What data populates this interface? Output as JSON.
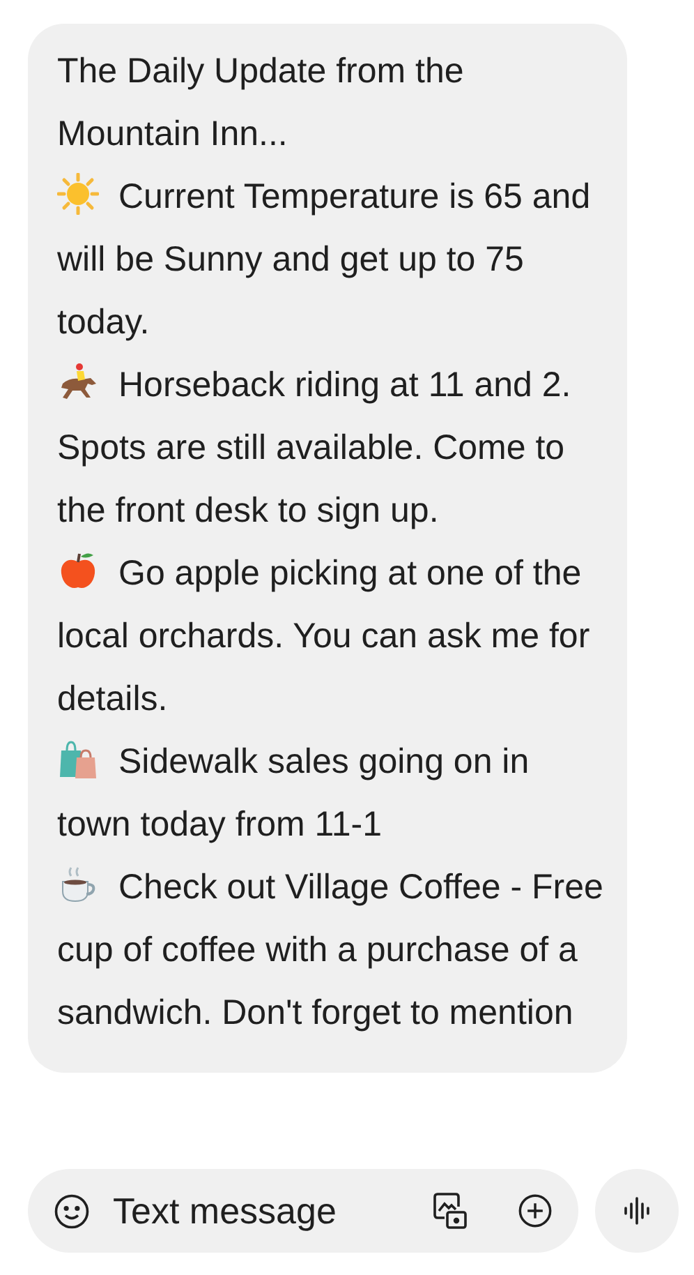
{
  "message": {
    "intro": "The Daily Update from the Mountain Inn...",
    "items": [
      {
        "kind": "sun",
        "text": "Current Temperature is 65 and will be Sunny and get up to 75 today."
      },
      {
        "kind": "horse",
        "text": "Horseback riding at 11 and 2. Spots are still available. Come to the front desk to sign up."
      },
      {
        "kind": "apple",
        "text": "Go apple picking at one of the local orchards. You can ask me for details."
      },
      {
        "kind": "bags",
        "text": "Sidewalk sales going on in town today from 11-1"
      },
      {
        "kind": "coffee",
        "text": "Check out Village Coffee - Free cup of coffee with a purchase of a sandwich. Don't forget to mention"
      }
    ]
  },
  "compose": {
    "placeholder": "Text message"
  }
}
